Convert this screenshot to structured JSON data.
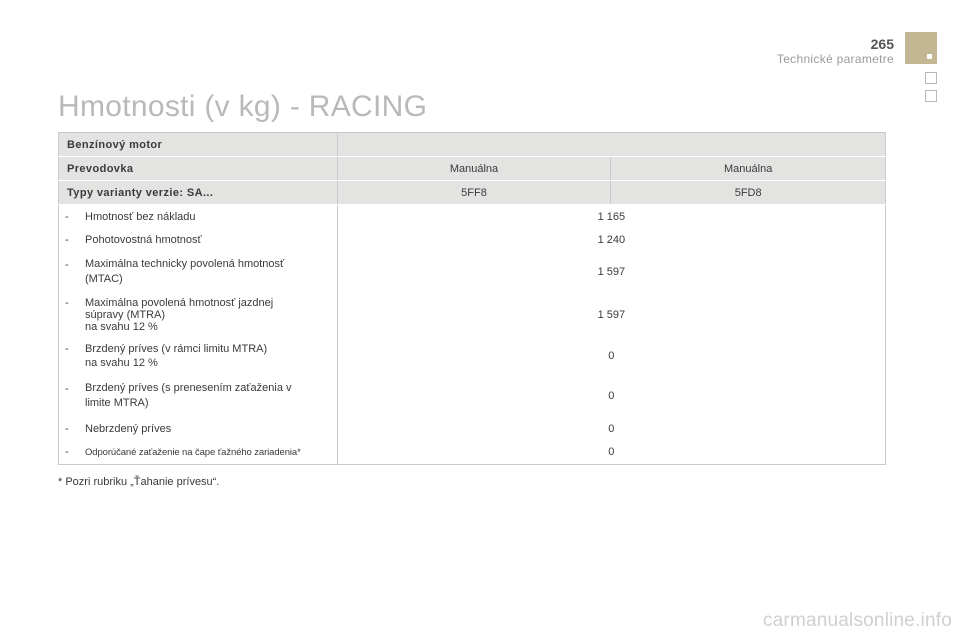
{
  "header": {
    "page_number": "265",
    "section_title": "Technické parametre"
  },
  "title": "Hmotnosti (v kg) - RACING",
  "table": {
    "engine_label": "Benzínový motor",
    "gearbox_label": "Prevodovka",
    "gearbox_values": [
      "Manuálna",
      "Manuálna"
    ],
    "variant_label": "Typy varianty verzie: SA...",
    "variant_values": [
      "5FF8",
      "5FD8"
    ],
    "rows": [
      {
        "dash": "-",
        "label": "Hmotnosť bez nákladu",
        "value": "1 165"
      },
      {
        "dash": "-",
        "label": "Pohotovostná hmotnosť",
        "value": "1 240"
      },
      {
        "dash": "-",
        "label": "Maximálna technicky povolená hmotnosť",
        "label2": "(MTAC)",
        "value": "1 597"
      },
      {
        "dash": "-",
        "label": "Maximálna povolená hmotnosť jazdnej",
        "label2": "súpravy (MTRA)",
        "label3": "na svahu 12 %",
        "value": "1 597"
      },
      {
        "dash": "-",
        "label": "Brzdený príves (v rámci limitu MTRA)",
        "label2": "na svahu 12 %",
        "value": "0"
      },
      {
        "dash": "-",
        "label": "Brzdený príves (s prenesením zaťaženia v",
        "label2": "limite MTRA)",
        "value": "0"
      },
      {
        "dash": "-",
        "label": "Nebrzdený príves",
        "value": "0"
      },
      {
        "dash": "-",
        "label": "Odporúčané zaťaženie na čape ťažného zariadenia*",
        "value": "0"
      }
    ]
  },
  "footnote": "* Pozri rubriku „Ťahanie prívesu“.",
  "watermark": "carmanualsonline.info"
}
